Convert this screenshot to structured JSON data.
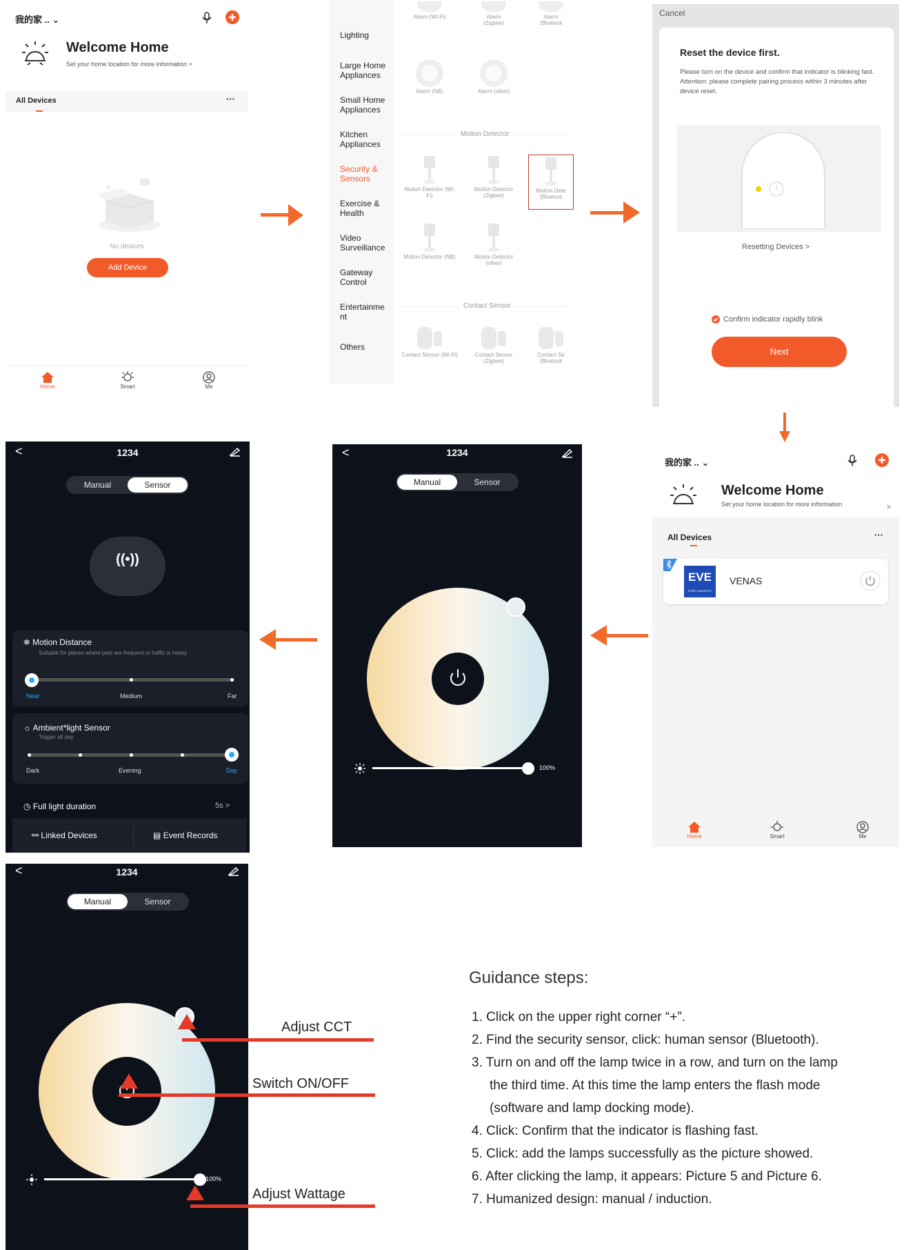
{
  "p1": {
    "home_title": "我的家 ..",
    "welcome": "Welcome Home",
    "welcome_sub": "Set your home location for more information",
    "chev": ">",
    "tab": "All Devices",
    "more": "···",
    "empty": "No devices",
    "add_btn": "Add Device",
    "nav": [
      "Home",
      "Smart",
      "Me"
    ]
  },
  "p2": {
    "categories": [
      "Lighting",
      "Large Home Appliances",
      "Small Home Appliances",
      "Kitchen Appliances",
      "Security & Sensors",
      "Exercise & Health",
      "Video Surveillance",
      "Gateway Control",
      "Entertainme nt",
      "Others"
    ],
    "alarm_top": [
      "Alarm (Wi-Fi)",
      "Alarm (Zigbee)",
      "Alarm (Bluetoot"
    ],
    "alarm_row": [
      "Alarm (NB)",
      "Alarm (other)"
    ],
    "motion_title": "Motion Detector",
    "motion_row1": [
      "Motion Detector (Wi-Fi)",
      "Motion Detector (Zigbee)",
      "Motion Dete (Bluetoot"
    ],
    "motion_row2": [
      "Motion Detector (NB)",
      "Motion Detector (other)"
    ],
    "contact_title": "Contact Sensor",
    "contact_row": [
      "Contact Sensor (Wi-Fi)",
      "Contact Sensor (Zigbee)",
      "Contact Se (Bluetoot"
    ]
  },
  "p3": {
    "cancel": "Cancel",
    "title": "Reset the device first.",
    "desc1": "Please turn on the device and confirm that indicator is blinking fast.",
    "desc2": "Attention: please complete pairing process within 3 minutes after device reset.",
    "reset_link": "Resetting Devices >",
    "confirm": "Confirm indicator rapidly blink",
    "next": "Next"
  },
  "p4": {
    "home_title": "我的家 ..",
    "welcome": "Welcome Home",
    "welcome_sub": "Set your home location for more information",
    "chev": ">",
    "tab": "All Devices",
    "more": "···",
    "device_name": "VENAS",
    "logo": "EVE",
    "logo_sub": "EVERY INDUSTRY",
    "nav": [
      "Home",
      "Smart",
      "Me"
    ]
  },
  "p5": {
    "back": "<",
    "title": "1234",
    "tabs": [
      "Manual",
      "Sensor"
    ],
    "pct": "100%",
    "brightness": 1.0
  },
  "p6": {
    "back": "<",
    "title": "1234",
    "tabs": [
      "Manual",
      "Sensor"
    ],
    "motion_title": "Motion Distance",
    "motion_sub": "Suitable for places where pets are frequent or traffic is heavy",
    "motion_labels": [
      "Near",
      "Medium",
      "Far"
    ],
    "ambient_title": "Ambient*light Sensor",
    "ambient_sub": "Trigger all day",
    "ambient_labels": [
      "Dark",
      "Evening",
      "Day"
    ],
    "full_light": "Full light duration",
    "full_light_val": "5s",
    "full_light_chev": ">",
    "linked": "Linked Devices",
    "events": "Event Records"
  },
  "p7": {
    "back": "<",
    "title": "1234",
    "tabs": [
      "Manual",
      "Sensor"
    ],
    "pct": "100%",
    "brightness": 1.0
  },
  "annotations": [
    "Adjust CCT",
    "Switch ON/OFF",
    "Adjust Wattage"
  ],
  "guide": {
    "title": "Guidance steps:",
    "steps": [
      "1. Click on the upper right corner “+”.",
      "2. Find the security sensor, click: human sensor (Bluetooth).",
      "3. Turn on and off the lamp twice in a row, and turn on the lamp",
      "the third time. At this time the lamp enters the flash mode",
      "(software and lamp docking mode).",
      "4. Click: Confirm that the indicator is flashing fast.",
      "5. Click: add the lamps successfully as the picture showed.",
      "6. After clicking the lamp, it appears: Picture 5 and Picture 6.",
      "7. Humanized design: manual / induction."
    ]
  },
  "colors": {
    "accent": "#f25a2a",
    "arrow": "#f26a2a",
    "dark_bg": "#0d111a",
    "selected": "#2aa9f5"
  }
}
